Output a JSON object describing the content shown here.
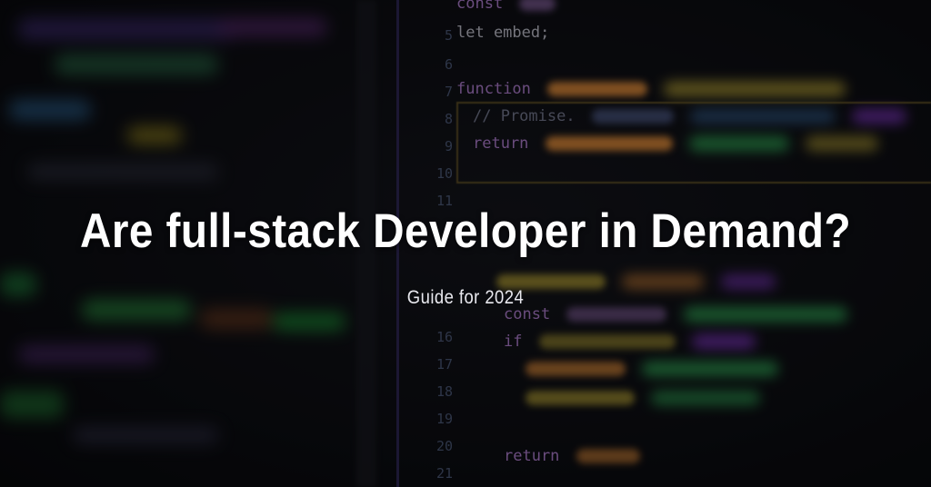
{
  "hero": {
    "title": "Are full-stack Developer in Demand?",
    "subtitle": "Guide for 2024"
  },
  "code": {
    "line_numbers": [
      "5",
      "6",
      "7",
      "8",
      "9",
      "10",
      "11",
      "16",
      "17",
      "18",
      "19",
      "20",
      "21"
    ],
    "visible_snippets": {
      "const_prefix": "const",
      "let_embed": "let embed;",
      "function_kw": "function",
      "promise_comment": "// Promise.",
      "return_kw": "return",
      "const_kw": "const",
      "if_kw": "if",
      "return_kw_2": "return"
    }
  },
  "colors": {
    "keyword": "#b784d9",
    "function": "#dd8a3a",
    "comment": "#7a7f96",
    "line_number": "#5b6a8e",
    "accent_green": "#3bd46a",
    "accent_purple": "#8a3bd4"
  }
}
